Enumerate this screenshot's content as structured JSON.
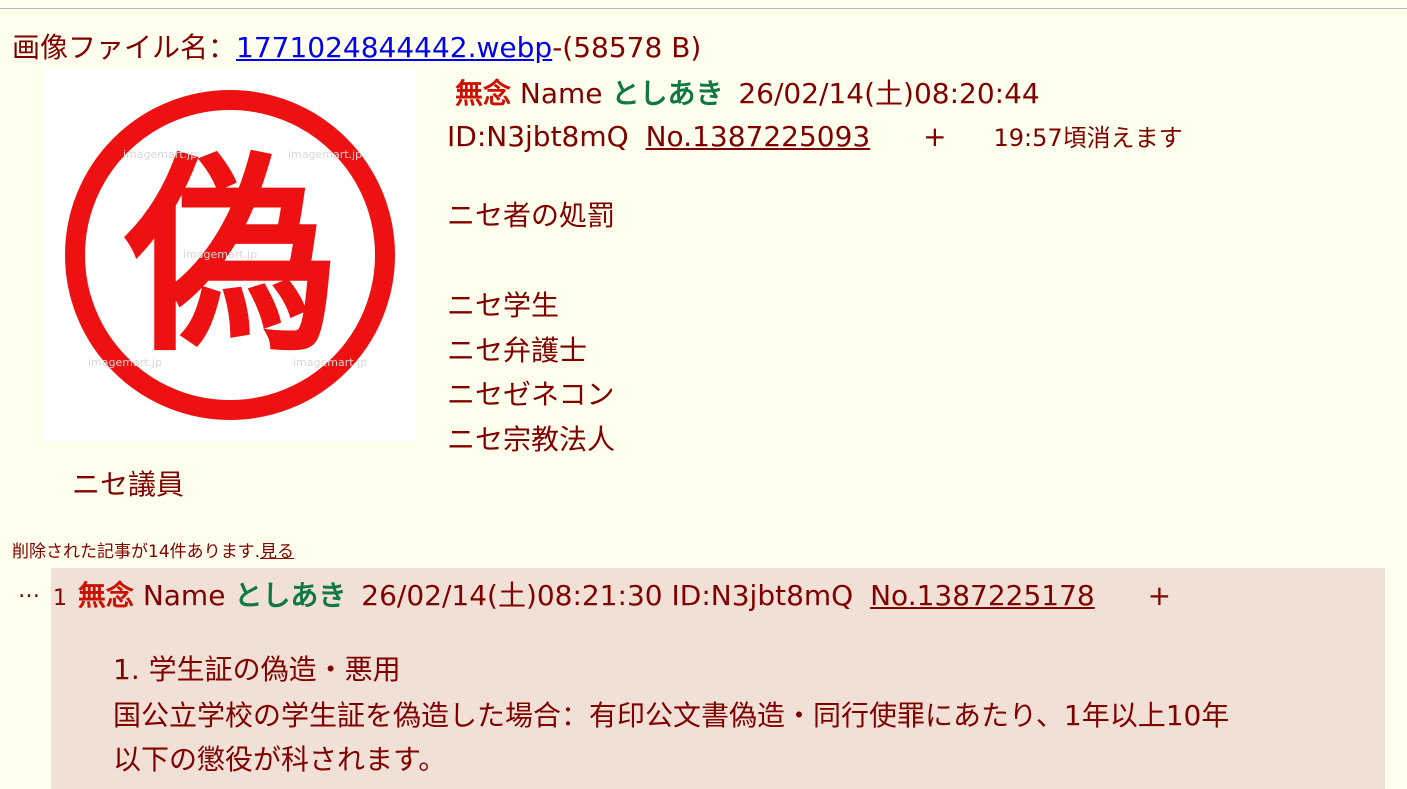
{
  "file": {
    "label": "画像ファイル名：",
    "filename": "1771024844442.webp",
    "size": "-(58578 B)"
  },
  "thumbnail": {
    "character": "偽",
    "watermark": "imagemart.jp"
  },
  "op": {
    "subject": "無念",
    "name_label": "Name",
    "name": "としあき",
    "date": "26/02/14(土)08:20:44",
    "id": "ID:N3jbt8mQ",
    "no": "No.1387225093",
    "plus": "+",
    "expire": "19:57頃消えます",
    "lines": [
      "ニセ者の処罰",
      "ニセ学生",
      "ニセ弁護士",
      "ニセゼネコン",
      "ニセ宗教法人",
      "ニセ議員"
    ]
  },
  "deleted": {
    "text": "削除された記事が14件あります.",
    "link": "見る"
  },
  "reply": {
    "prefix": "…",
    "index": "1",
    "subject": "無念",
    "name_label": "Name",
    "name": "としあき",
    "date": "26/02/14(土)08:21:30",
    "id": "ID:N3jbt8mQ",
    "no": "No.1387225178",
    "plus": "+",
    "lines": [
      "1. 学生証の偽造・悪用",
      "国公立学校の学生証を偽造した場合：有印公文書偽造・同行使罪にあたり、1年以上10年",
      "以下の懲役が科されます。"
    ]
  }
}
